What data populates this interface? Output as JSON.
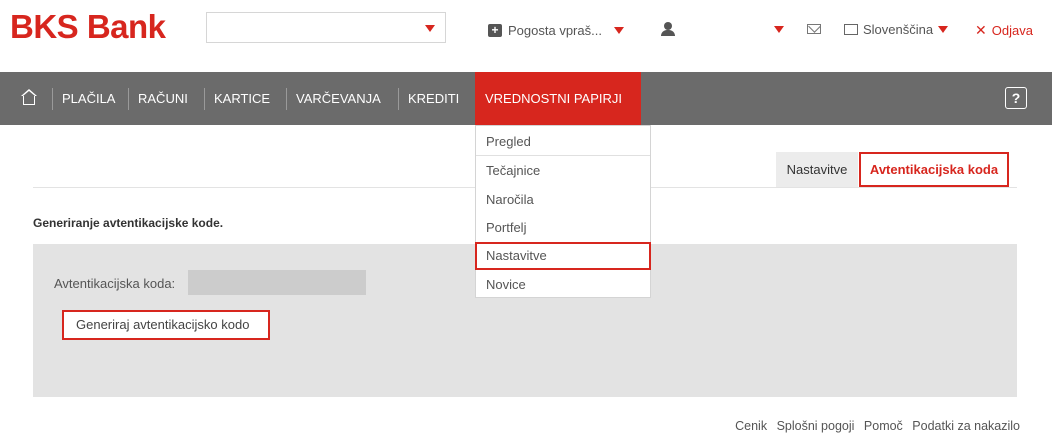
{
  "brand": {
    "name": "BKS Bank",
    "color": "#d7261e"
  },
  "header": {
    "faq_label": "Pogosta vpraš...",
    "language_label": "Slovenščina",
    "logout_label": "Odjava",
    "logout_symbol": "✕"
  },
  "nav": {
    "items": [
      "PLAČILA",
      "RAČUNI",
      "KARTICE",
      "VARČEVANJA",
      "KREDITI"
    ],
    "active": "VREDNOSTNI PAPIRJI",
    "help_label": "?"
  },
  "dropdown": {
    "items": [
      "Pregled",
      "Tečajnice",
      "Naročila",
      "Portfelj",
      "Nastavitve",
      "Novice"
    ],
    "highlighted_index": 4
  },
  "tabs": {
    "settings": "Nastavitve",
    "auth_code": "Avtentikacijska koda"
  },
  "content": {
    "section_title": "Generiranje avtentikacijske kode.",
    "auth_label": "Avtentikacijska koda:",
    "auth_value": "",
    "generate_button": "Generiraj avtentikacijsko kodo"
  },
  "footer": {
    "links": [
      "Cenik",
      "Splošni pogoji",
      "Pomoč",
      "Podatki za nakazilo"
    ]
  }
}
